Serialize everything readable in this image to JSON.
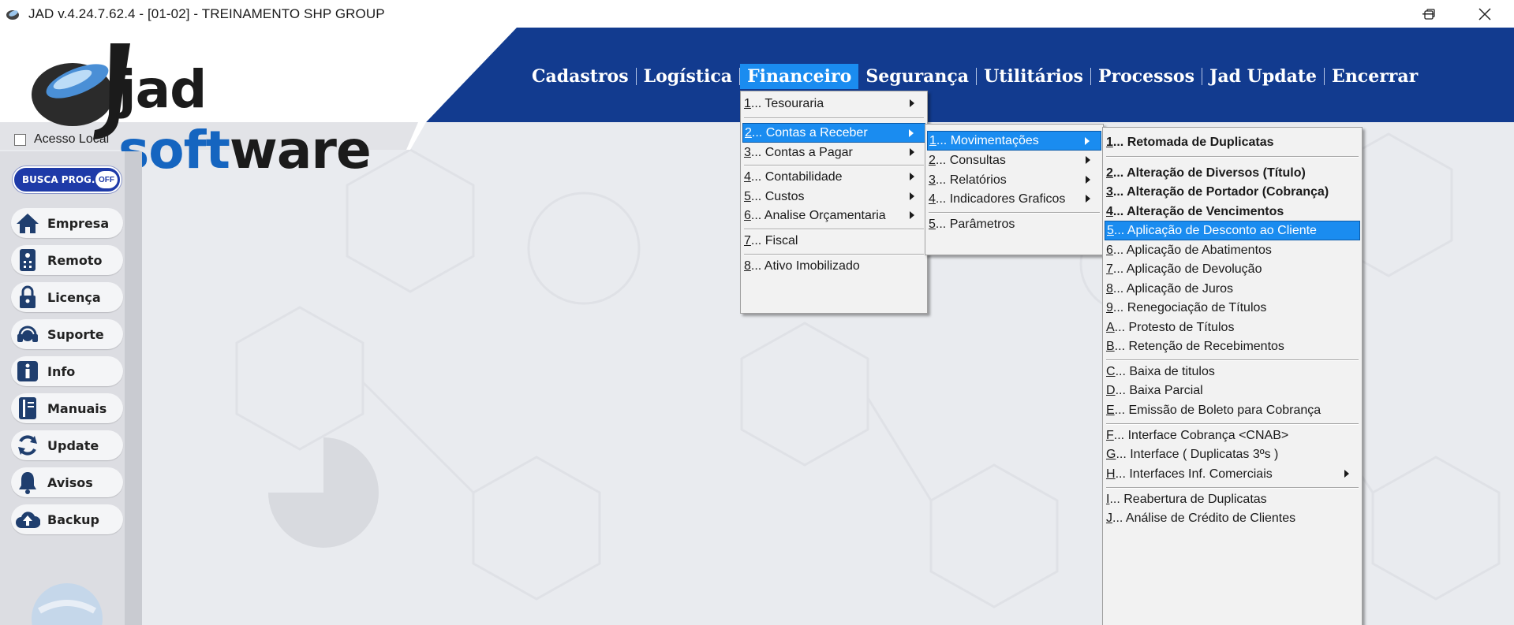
{
  "window": {
    "title": "JAD v.4.24.7.62.4 - [01-02] - TREINAMENTO SHP GROUP"
  },
  "logo": {
    "part1": "jad ",
    "part2": "soft",
    "part3": "ware"
  },
  "menubar": [
    "Cadastros",
    "Logística",
    "Financeiro",
    "Segurança",
    "Utilitários",
    "Processos",
    "Jad Update",
    "Encerrar"
  ],
  "sidebar": {
    "acesso_local": "Acesso Local",
    "busca": {
      "label": "BUSCA PROG.",
      "state": "OFF"
    },
    "buttons": [
      "Empresa",
      "Remoto",
      "Licença",
      "Suporte",
      "Info",
      "Manuais",
      "Update",
      "Avisos",
      "Backup"
    ]
  },
  "financeiro_menu": [
    {
      "key": "1",
      "label": "... Tesouraria"
    },
    {
      "key": "2",
      "label": "... Contas a Receber"
    },
    {
      "key": "3",
      "label": "... Contas a Pagar"
    },
    {
      "key": "4",
      "label": "... Contabilidade"
    },
    {
      "key": "5",
      "label": "... Custos"
    },
    {
      "key": "6",
      "label": "... Analise Orçamentaria"
    },
    {
      "key": "7",
      "label": "... Fiscal"
    },
    {
      "key": "8",
      "label": "... Ativo Imobilizado"
    }
  ],
  "contas_receber_menu": [
    {
      "key": "1",
      "label": "... Movimentações"
    },
    {
      "key": "2",
      "label": "... Consultas"
    },
    {
      "key": "3",
      "label": "... Relatórios"
    },
    {
      "key": "4",
      "label": "... Indicadores Graficos"
    },
    {
      "key": "5",
      "label": "... Parâmetros"
    }
  ],
  "movimentacoes_menu": [
    {
      "key": "1",
      "label": "... Retomada de Duplicatas"
    },
    {
      "key": "2",
      "label": "... Alteração de Diversos (Título)"
    },
    {
      "key": "3",
      "label": "... Alteração de Portador (Cobrança)"
    },
    {
      "key": "4",
      "label": "... Alteração de Vencimentos"
    },
    {
      "key": "5",
      "label": "... Aplicação de Desconto ao Cliente"
    },
    {
      "key": "6",
      "label": "... Aplicação de Abatimentos"
    },
    {
      "key": "7",
      "label": "... Aplicação de Devolução"
    },
    {
      "key": "8",
      "label": "... Aplicação de Juros"
    },
    {
      "key": "9",
      "label": "... Renegociação de Títulos"
    },
    {
      "key": "A",
      "label": "... Protesto de Títulos"
    },
    {
      "key": "B",
      "label": "... Retenção de Recebimentos"
    },
    {
      "key": "C",
      "label": "... Baixa de titulos"
    },
    {
      "key": "D",
      "label": "... Baixa Parcial"
    },
    {
      "key": "E",
      "label": "... Emissão de Boleto para Cobrança"
    },
    {
      "key": "F",
      "label": "... Interface Cobrança <CNAB>"
    },
    {
      "key": "G",
      "label": "... Interface ( Duplicatas 3ºs )"
    },
    {
      "key": "H",
      "label": "... Interfaces Inf. Comerciais"
    },
    {
      "key": "I",
      "label": "... Reabertura de Duplicatas"
    },
    {
      "key": "J",
      "label": "... Análise de Crédito de Clientes"
    }
  ],
  "colors": {
    "header_blue": "#123b8f",
    "highlight": "#1a8cf0"
  }
}
